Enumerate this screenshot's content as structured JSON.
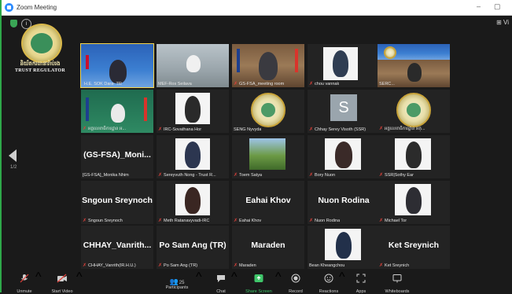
{
  "window": {
    "title": "Zoom Meeting",
    "minimize": "–",
    "restore": "▢"
  },
  "top": {
    "view_label": "Vi"
  },
  "org": {
    "name_kh": "និយ័តករធានារ៉ាប់រង",
    "name_en": "TRUST REGULATOR"
  },
  "pager": {
    "page": "1/2"
  },
  "tiles": [
    {
      "label": "H.E. SOK Dara- TR",
      "muted": false
    },
    {
      "label": "MEF-Ros Seilava",
      "muted": false
    },
    {
      "label": "GS-FSA_meeting room",
      "muted": true
    },
    {
      "label": "chou vannak",
      "muted": true
    },
    {
      "label": "SERC...",
      "muted": false
    },
    {
      "label": "អគ្គលេខាធិការដ្ឋាន អ...",
      "muted": true
    },
    {
      "label": "IRC-Sovathana Hor",
      "muted": true
    },
    {
      "label": "SENG Nyvyda",
      "muted": false
    },
    {
      "label": "Chhay Serey Visoth (SSR)",
      "muted": true
    },
    {
      "label": "អគ្គលេខាធិការដ្ឋាន អគ្...",
      "muted": true
    },
    {
      "label": "[GS-FSA]_Monika Nhim",
      "muted": false,
      "big_name": "(GS-FSA)_Moni..."
    },
    {
      "label": "Sereyvuth Nong - Trust R...",
      "muted": true
    },
    {
      "label": "Toem Satya",
      "muted": true
    },
    {
      "label": "Bory Nuon",
      "muted": true
    },
    {
      "label": "SSR|Sothy Ear",
      "muted": true
    },
    {
      "label": "Sngoun Sreynoch",
      "muted": true,
      "big_name": "Sngoun Sreynoch"
    },
    {
      "label": "Meth Ratanavyvadi-IRC",
      "muted": true
    },
    {
      "label": "Eahai Khov",
      "muted": true,
      "big_name": "Eahai Khov"
    },
    {
      "label": "Nuon Rodina",
      "muted": true,
      "big_name": "Nuon Rodina"
    },
    {
      "label": "Michael Tor",
      "muted": true
    },
    {
      "label": "CHHAY_Vanrith(IR.H.U.)",
      "muted": true,
      "big_name": "CHHAY_Vanrith..."
    },
    {
      "label": "Po Sam Ang (TR)",
      "muted": true,
      "big_name": "Po Sam Ang (TR)"
    },
    {
      "label": "Maraden",
      "muted": true,
      "big_name": "Maraden"
    },
    {
      "label": "Bean Kheangchou",
      "muted": false
    },
    {
      "label": "Ket Sreynich",
      "muted": true,
      "big_name": "Ket Sreynich"
    }
  ],
  "toolbar": {
    "unmute": "Unmute",
    "start_video": "Start Video",
    "participants": "Participants",
    "participants_count": "25",
    "chat": "Chat",
    "share_screen": "Share Screen",
    "record": "Record",
    "reactions": "Reactions",
    "apps": "Apps",
    "whiteboards": "Whiteboards"
  },
  "colors": {
    "active_speaker": "#f3d34a",
    "muted_mic": "#e0413a",
    "share_green": "#3fc66a",
    "zoom_blue": "#2d8cff"
  }
}
